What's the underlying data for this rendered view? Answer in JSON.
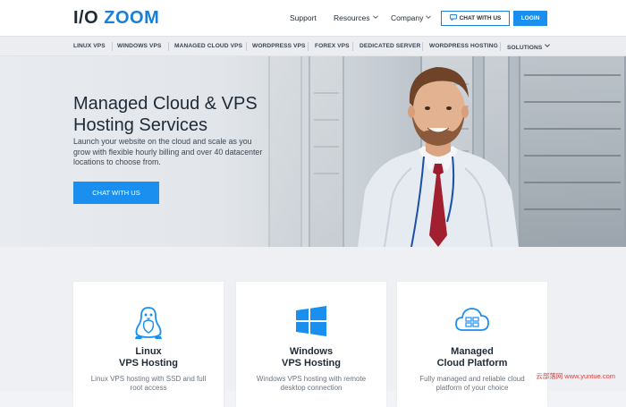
{
  "brand": {
    "logo_io": "I/O",
    "logo_zoom": "ZOOM"
  },
  "header": {
    "support": "Support",
    "resources": "Resources",
    "company": "Company",
    "chat_label": "CHAT WITH US",
    "login_label": "LOGIN"
  },
  "subnav": {
    "items": [
      "LINUX VPS",
      "WINDOWS VPS",
      "MANAGED CLOUD VPS",
      "WORDPRESS VPS",
      "FOREX VPS",
      "DEDICATED SERVER",
      "WORDPRESS HOSTING",
      "SOLUTIONS"
    ]
  },
  "hero": {
    "title": "Managed Cloud & VPS Hosting Services",
    "description": "Launch your website on the cloud and scale as you grow with flexible hourly billing and over 40 datacenter locations to choose from.",
    "cta_label": "CHAT WITH US"
  },
  "cards": [
    {
      "icon": "linux-penguin-icon",
      "title_line1": "Linux",
      "title_line2": "VPS Hosting",
      "desc": "Linux VPS hosting with SSD and full root access"
    },
    {
      "icon": "windows-logo-icon",
      "title_line1": "Windows",
      "title_line2": "VPS Hosting",
      "desc": "Windows VPS hosting with remote desktop connection"
    },
    {
      "icon": "cloud-platform-icon",
      "title_line1": "Managed",
      "title_line2": "Cloud Platform",
      "desc": "Fully managed and reliable cloud platform of your choice"
    }
  ],
  "watermark": {
    "cn": "云部落网",
    "url": "www.yuntue.com"
  },
  "colors": {
    "accent": "#1b8ff0",
    "brand_blue": "#1b7fd6",
    "text_dark": "#1f2a37"
  }
}
